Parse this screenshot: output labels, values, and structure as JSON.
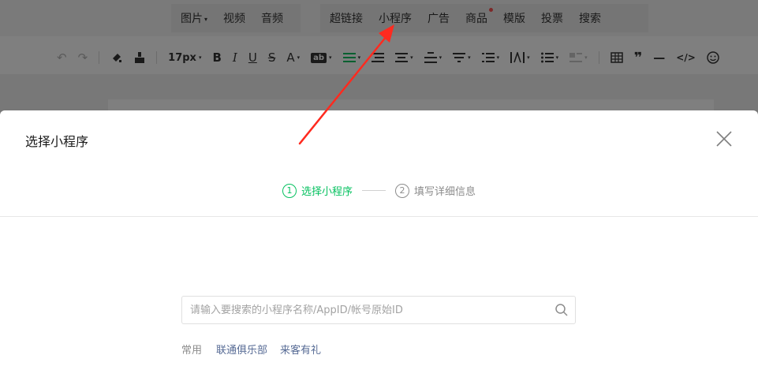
{
  "menu": {
    "group1": [
      {
        "label": "图片",
        "caret": "▾"
      },
      {
        "label": "视频"
      },
      {
        "label": "音频"
      }
    ],
    "group2": [
      {
        "label": "超链接"
      },
      {
        "label": "小程序"
      },
      {
        "label": "广告"
      },
      {
        "label": "商品",
        "dot": true
      },
      {
        "label": "模版"
      },
      {
        "label": "投票"
      },
      {
        "label": "搜索"
      }
    ]
  },
  "toolbar": {
    "undo": "↶",
    "redo": "↷",
    "font_size": "17px",
    "bold": "B",
    "italic": "I",
    "underline": "U",
    "strike": "S",
    "font_color": "A",
    "bg_color": "ab",
    "quote": "❞",
    "hr": "—",
    "code": "</>"
  },
  "dialog": {
    "title": "选择小程序",
    "steps": [
      {
        "num": "1",
        "label": "选择小程序",
        "state": "active"
      },
      {
        "num": "2",
        "label": "填写详细信息",
        "state": "inactive"
      }
    ],
    "search": {
      "placeholder": "请输入要搜索的小程序名称/AppID/帐号原始ID",
      "value": ""
    },
    "common": {
      "label": "常用",
      "items": [
        "联通俱乐部",
        "来客有礼"
      ]
    }
  },
  "colors": {
    "accent": "#07c160",
    "link": "#576b95",
    "arrow": "#ff2a1f"
  },
  "icons": {
    "close": "close-icon",
    "search": "search-icon"
  }
}
